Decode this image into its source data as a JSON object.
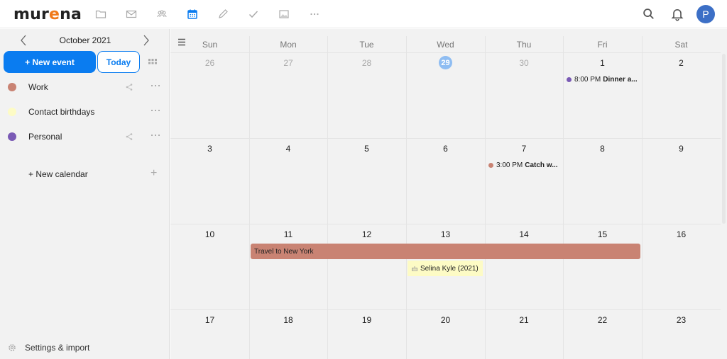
{
  "topbar": {
    "logo_main": "mur",
    "logo_e": "e",
    "logo_end": "na",
    "apps": [
      {
        "name": "files",
        "icon": "folder-icon",
        "active": false
      },
      {
        "name": "mail",
        "icon": "mail-icon",
        "active": false
      },
      {
        "name": "contacts",
        "icon": "contacts-icon",
        "active": false
      },
      {
        "name": "calendar",
        "icon": "calendar-icon",
        "active": true
      },
      {
        "name": "notes",
        "icon": "pencil-icon",
        "active": false
      },
      {
        "name": "tasks",
        "icon": "check-icon",
        "active": false
      },
      {
        "name": "photos",
        "icon": "image-icon",
        "active": false
      },
      {
        "name": "more",
        "icon": "more-icon",
        "active": false
      }
    ],
    "avatar_initial": "P",
    "colors": {
      "accent": "#0a7cf0",
      "avatar": "#3c6fc6",
      "logo_e": "#f07a1a"
    }
  },
  "sidebar": {
    "month_title": "October 2021",
    "new_event_label": "+ New event",
    "today_label": "Today",
    "calendars": [
      {
        "name": "Work",
        "color": "#c98373",
        "shared": true
      },
      {
        "name": "Contact birthdays",
        "color": "#fdfbc5",
        "shared": false
      },
      {
        "name": "Personal",
        "color": "#7a5ab5",
        "shared": true
      }
    ],
    "new_calendar_label": "+ New calendar",
    "settings_label": "Settings & import"
  },
  "main": {
    "weekdays": [
      "Sun",
      "Mon",
      "Tue",
      "Wed",
      "Thu",
      "Fri",
      "Sat"
    ],
    "weeks": [
      [
        {
          "d": "26",
          "other": true
        },
        {
          "d": "27",
          "other": true
        },
        {
          "d": "28",
          "other": true
        },
        {
          "d": "29",
          "other": true,
          "today": true
        },
        {
          "d": "30",
          "other": true
        },
        {
          "d": "1"
        },
        {
          "d": "2"
        }
      ],
      [
        {
          "d": "3"
        },
        {
          "d": "4"
        },
        {
          "d": "5"
        },
        {
          "d": "6"
        },
        {
          "d": "7"
        },
        {
          "d": "8"
        },
        {
          "d": "9"
        }
      ],
      [
        {
          "d": "10"
        },
        {
          "d": "11"
        },
        {
          "d": "12"
        },
        {
          "d": "13"
        },
        {
          "d": "14"
        },
        {
          "d": "15"
        },
        {
          "d": "16"
        }
      ],
      [
        {
          "d": "17"
        },
        {
          "d": "18"
        },
        {
          "d": "19"
        },
        {
          "d": "20"
        },
        {
          "d": "21"
        },
        {
          "d": "22"
        },
        {
          "d": "23"
        }
      ]
    ],
    "events": {
      "dinner": {
        "time": "8:00 PM",
        "title": "Dinner a...",
        "color": "#7a5ab5"
      },
      "catch": {
        "time": "3:00 PM",
        "title": "Catch w...",
        "color": "#c98373"
      },
      "travel": {
        "title": "Travel to New York",
        "color": "#c98373"
      },
      "birthday": {
        "title": "Selina Kyle (2021)",
        "color": "#fdfbc5"
      }
    }
  }
}
